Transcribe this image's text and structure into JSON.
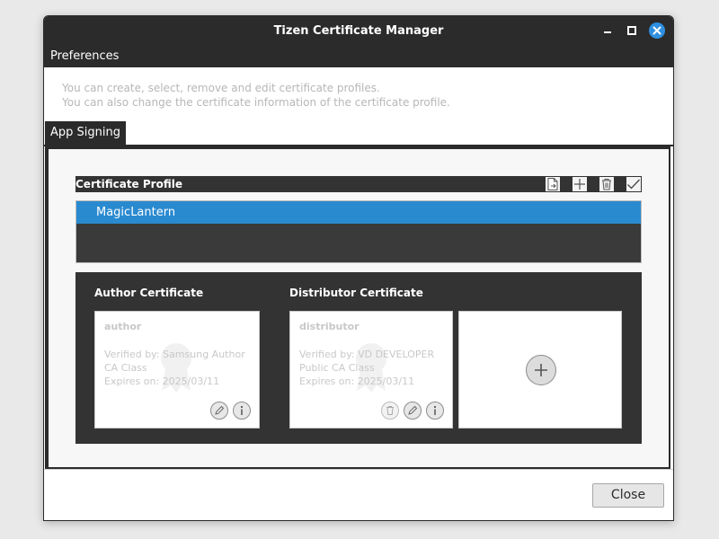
{
  "window": {
    "title": "Tizen Certificate Manager"
  },
  "menubar": {
    "preferences": "Preferences"
  },
  "description": {
    "line1": "You can create, select, remove and edit certificate profiles.",
    "line2": "You can also change the certificate information of the certificate profile."
  },
  "tabs": [
    {
      "label": "App Signing",
      "active": true
    }
  ],
  "profile": {
    "header": "Certificate Profile",
    "toolbar": [
      "export-icon",
      "add-icon",
      "trash-icon",
      "check-icon"
    ],
    "items": [
      {
        "name": "MagicLantern",
        "selected": true
      }
    ]
  },
  "author": {
    "section_title": "Author Certificate",
    "name": "author",
    "verified_by": "Verified by: Samsung Author",
    "ca_class": "CA Class",
    "expires": "Expires on: 2025/03/11"
  },
  "distributor": {
    "section_title": "Distributor Certificate",
    "name": "distributor",
    "verified_by": "Verified by: VD DEVELOPER",
    "ca_class": "Public CA Class",
    "expires": "Expires on: 2025/03/11"
  },
  "footer": {
    "close_label": "Close"
  },
  "colors": {
    "accent": "#2a8ad0",
    "titlebar": "#2b2b2b",
    "panel_dark": "#333333",
    "close_window_button": "#2f8fe0"
  }
}
